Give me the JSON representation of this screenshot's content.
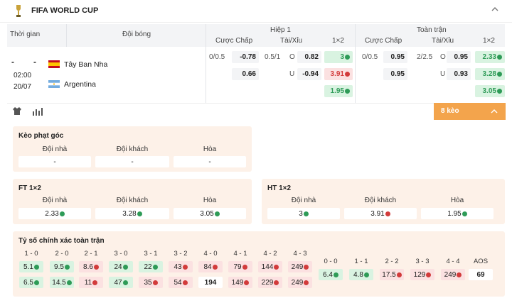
{
  "header": {
    "title": "FIFA WORLD CUP"
  },
  "table": {
    "col_time": "Thời gian",
    "col_team": "Đội bóng",
    "half1": "Hiệp 1",
    "full": "Toàn trận",
    "sub": {
      "handicap": "Cược Chấp",
      "ou": "Tài/Xỉu",
      "x12": "1×2"
    }
  },
  "match": {
    "score_home": "-",
    "score_away": "-",
    "time": "02:00",
    "date": "20/07",
    "home": "Tây Ban Nha",
    "away": "Argentina"
  },
  "odds": {
    "h1": {
      "hcp_line": "0/0.5",
      "hcp_home": "-0.78",
      "hcp_away": "0.66",
      "ou_line": "0.5/1",
      "ou_o": "O",
      "ou_u": "U",
      "ou_over": "0.82",
      "ou_under": "-0.94",
      "x1": "3",
      "x2": "3.91",
      "xd": "1.95"
    },
    "ft": {
      "hcp_line": "0/0.5",
      "hcp_home": "0.95",
      "hcp_away": "0.95",
      "ou_line": "2/2.5",
      "ou_o": "O",
      "ou_u": "U",
      "ou_over": "0.95",
      "ou_under": "0.93",
      "x1": "2.33",
      "x2": "3.28",
      "xd": "3.05"
    }
  },
  "toolbar": {
    "more_label": "8 kèo"
  },
  "corner": {
    "title": "Kèo phạt góc",
    "labels": [
      "Đội nhà",
      "Đội khách",
      "Hòa"
    ],
    "values": [
      "-",
      "-",
      "-"
    ]
  },
  "ft12": {
    "title": "FT 1×2",
    "labels": [
      "Đội nhà",
      "Đội khách",
      "Hòa"
    ],
    "values": [
      "2.33",
      "3.28",
      "3.05"
    ]
  },
  "ht12": {
    "title": "HT 1×2",
    "labels": [
      "Đội nhà",
      "Đội khách",
      "Hòa"
    ],
    "values": [
      "3",
      "3.91",
      "1.95"
    ]
  },
  "scores": {
    "title": "Tỷ số chính xác toàn trận",
    "home_labels": [
      "1 - 0",
      "2 - 0",
      "2 - 1",
      "3 - 0",
      "3 - 1",
      "3 - 2",
      "4 - 0",
      "4 - 1",
      "4 - 2",
      "4 - 3"
    ],
    "home_row1": [
      "5.1",
      "9.5",
      "8.6",
      "24",
      "22",
      "43",
      "84",
      "79",
      "144",
      "249"
    ],
    "home_row1_dir": [
      "up",
      "up",
      "dn",
      "up",
      "up",
      "dn",
      "dn",
      "dn",
      "dn",
      "dn"
    ],
    "home_row2": [
      "6.5",
      "14.5",
      "11",
      "47",
      "35",
      "54",
      "194",
      "149",
      "229",
      "249"
    ],
    "home_row2_dir": [
      "up",
      "up",
      "dn",
      "up",
      "dn",
      "dn",
      "none",
      "dn",
      "dn",
      "dn"
    ],
    "draw_labels": [
      "0 - 0",
      "1 - 1",
      "2 - 2",
      "3 - 3",
      "4 - 4",
      "AOS"
    ],
    "draw_row": [
      "6.4",
      "4.8",
      "17.5",
      "129",
      "249",
      "69"
    ],
    "draw_dir": [
      "up",
      "up",
      "dn",
      "dn",
      "dn",
      "none"
    ]
  },
  "colors": {
    "accent": "#f3a44c",
    "up": "#2e9b57",
    "down": "#d23b3b",
    "panel": "#fdf1e8"
  }
}
